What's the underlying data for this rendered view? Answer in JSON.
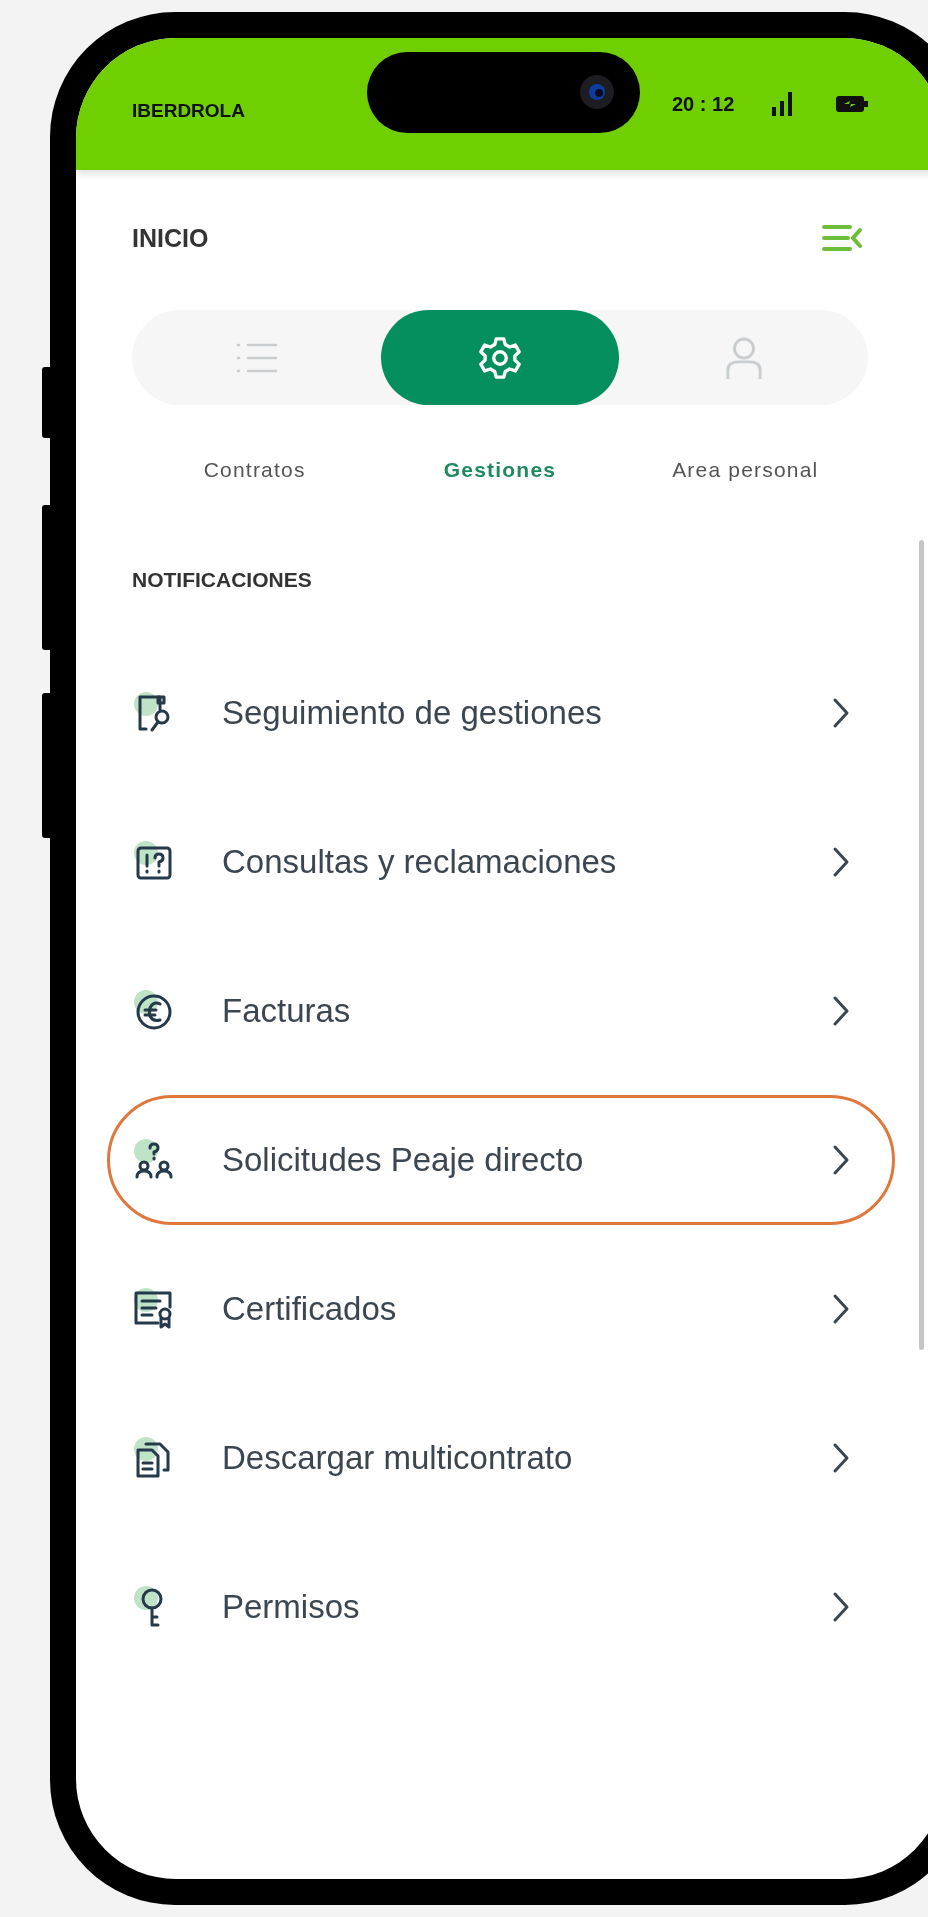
{
  "status_bar": {
    "carrier": "IBERDROLA",
    "time": "20 : 12"
  },
  "header": {
    "title": "INICIO"
  },
  "tabs": [
    {
      "label": "Contratos",
      "kind": "list",
      "selected": false
    },
    {
      "label": "Gestiones",
      "kind": "gear",
      "selected": true
    },
    {
      "label": "Area personal",
      "kind": "person",
      "selected": false
    }
  ],
  "section_title": "NOTIFICACIONES",
  "menu_items": [
    {
      "label": "Seguimiento de gestiones",
      "kind": "tracking",
      "highlighted": false
    },
    {
      "label": "Consultas y reclamaciones",
      "kind": "question",
      "highlighted": false
    },
    {
      "label": "Facturas",
      "kind": "euro",
      "highlighted": false
    },
    {
      "label": "Solicitudes Peaje directo",
      "kind": "people",
      "highlighted": true
    },
    {
      "label": "Certificados",
      "kind": "certificate",
      "highlighted": false
    },
    {
      "label": "Descargar multicontrato",
      "kind": "documents",
      "highlighted": false
    },
    {
      "label": "Permisos",
      "kind": "key",
      "highlighted": false
    }
  ]
}
